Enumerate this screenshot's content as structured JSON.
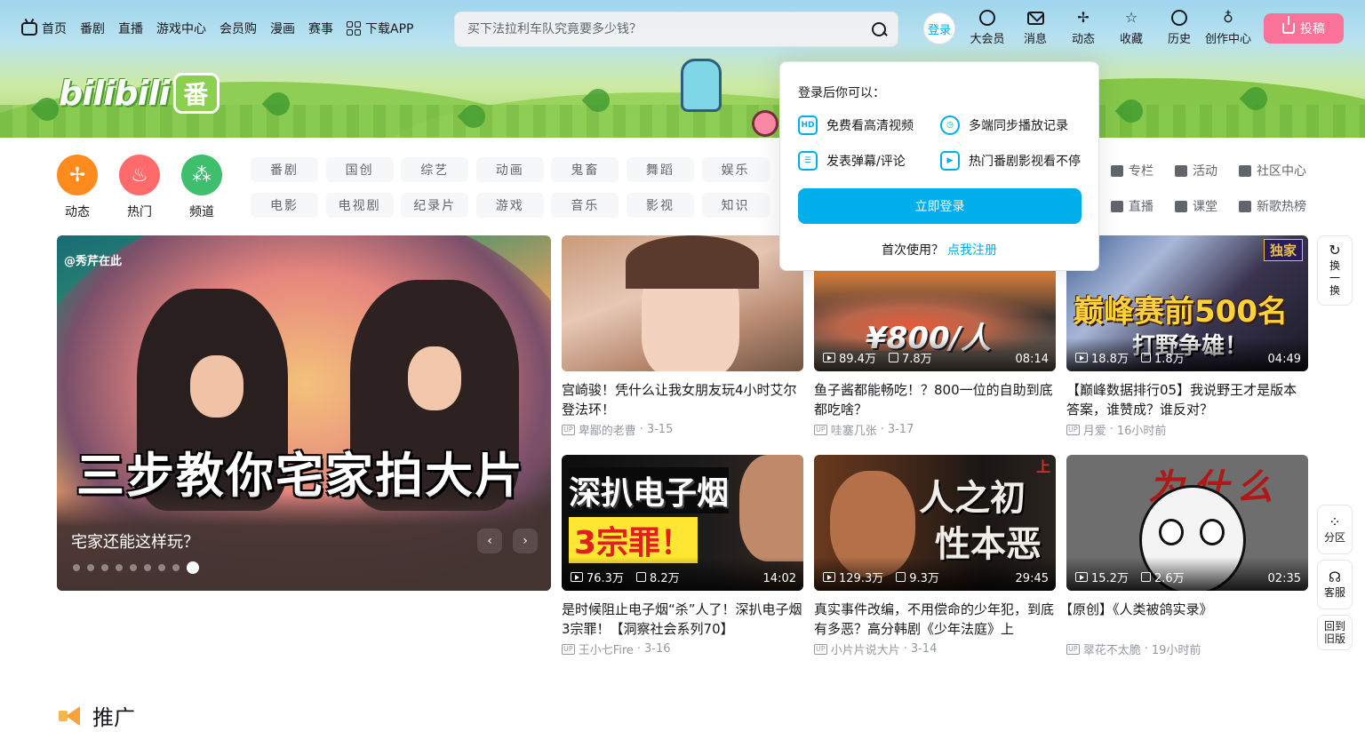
{
  "topnav": {
    "items": [
      "首页",
      "番剧",
      "直播",
      "游戏中心",
      "会员购",
      "漫画",
      "赛事"
    ],
    "download": "下载APP"
  },
  "search": {
    "placeholder": "买下法拉利车队究竟要多少钱？"
  },
  "logo": {
    "text": "bilibili",
    "badge": "番"
  },
  "user_nav": {
    "login": "登录",
    "items": [
      "大会员",
      "消息",
      "动态",
      "收藏",
      "历史",
      "创作中心"
    ],
    "upload": "投稿"
  },
  "channels": [
    {
      "label": "动态",
      "color": "#ff8b1f"
    },
    {
      "label": "热门",
      "color": "#ff6a6a"
    },
    {
      "label": "频道",
      "color": "#3fbf6e"
    }
  ],
  "tags_row1": [
    "番剧",
    "国创",
    "综艺",
    "动画",
    "鬼畜",
    "舞蹈",
    "娱乐"
  ],
  "tags_row2": [
    "电影",
    "电视剧",
    "纪录片",
    "游戏",
    "音乐",
    "影视",
    "知识"
  ],
  "right_links": [
    "专栏",
    "活动",
    "社区中心",
    "直播",
    "课堂",
    "新歌热榜"
  ],
  "carousel": {
    "handle": "@秀芹在此",
    "overlay": "三步教你宅家拍大片",
    "caption": "宅家还能这样玩？",
    "dot_count": 9,
    "active_index": 8
  },
  "videos": [
    {
      "title": "宫崎骏！凭什么让我女朋友玩4小时艾尔登法环！",
      "author": "卑鄙的老曹",
      "date": "3-15",
      "views": "",
      "likes": "",
      "duration": ""
    },
    {
      "title": "鱼子酱都能畅吃！？800一位的自助到底都吃啥？",
      "author": "哇塞几张",
      "date": "3-17",
      "views": "89.4万",
      "likes": "7.8万",
      "duration": "08:14",
      "cover_text": "¥800/人"
    },
    {
      "title": "【巅峰数据排行05】我说野王才是版本答案，谁赞成？谁反对？",
      "author": "月爱",
      "date": "16小时前",
      "views": "18.8万",
      "likes": "1.8万",
      "duration": "04:49",
      "cover_text": "巅峰赛前500名",
      "cover_sub": "打野争雄！",
      "cover_badge": "独家"
    },
    {
      "title": "是时候阻止电子烟“杀”人了！深扒电子烟3宗罪！【洞察社会系列70】",
      "author": "王小七Fire",
      "date": "3-16",
      "views": "76.3万",
      "likes": "8.2万",
      "duration": "14:02",
      "cover_text": "深扒电子烟",
      "cover_sub": "3宗罪！"
    },
    {
      "title": "真实事件改编，不用偿命的少年犯，到底有多恶？高分韩剧《少年法庭》上",
      "author": "小片片说大片",
      "date": "3-14",
      "views": "129.3万",
      "likes": "9.3万",
      "duration": "29:45",
      "cover_text": "人之初",
      "cover_sub": "性本恶",
      "cover_badge": "上"
    },
    {
      "title": "【原创】《人类被鸽实录》",
      "author": "翠花不太脆",
      "date": "19小时前",
      "views": "15.2万",
      "likes": "2.6万",
      "duration": "02:35",
      "cover_text": "为什么"
    }
  ],
  "login_popup": {
    "title": "登录后你可以：",
    "features": [
      "免费看高清视频",
      "多端同步播放记录",
      "发表弹幕/评论",
      "热门番剧影视看不停"
    ],
    "hd_badge": "HD",
    "button": "立即登录",
    "first_use": "首次使用？",
    "register": "点我注册"
  },
  "side": {
    "refresh": "换一换",
    "zone": "分区",
    "service": "客服",
    "old": "回到旧版"
  },
  "promo": {
    "title": "推广"
  }
}
